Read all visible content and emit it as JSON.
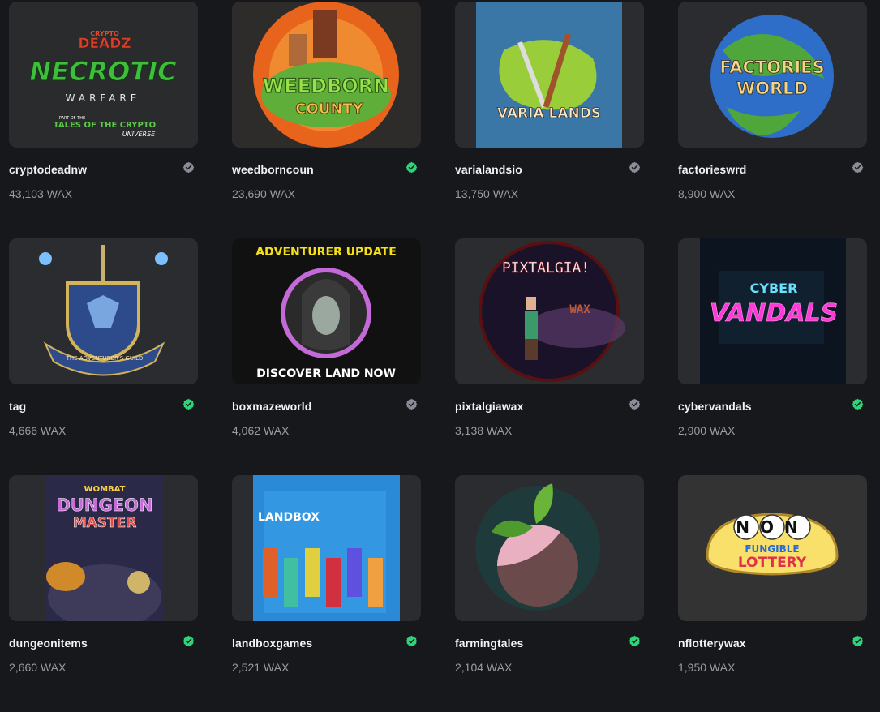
{
  "collections": [
    {
      "name": "cryptodeadnw",
      "volume": "43,103 WAX",
      "verified": false,
      "art": {
        "kind": "crypto",
        "top": "CRYPTO",
        "brand": "DEADZ",
        "title": "NECROTIC",
        "sub": "WARFARE",
        "tag1": "PART OF THE",
        "tag2": "TALES OF THE CRYPTO",
        "tag3": "UNIVERSE"
      }
    },
    {
      "name": "weedborncoun",
      "volume": "23,690 WAX",
      "verified": true,
      "art": {
        "kind": "weed",
        "title": "WEEDBORN",
        "sub": "COUNTY"
      }
    },
    {
      "name": "varialandsio",
      "volume": "13,750 WAX",
      "verified": false,
      "art": {
        "kind": "varia",
        "title": "VARIA LANDS"
      }
    },
    {
      "name": "factorieswrd",
      "volume": "8,900 WAX",
      "verified": false,
      "art": {
        "kind": "factories",
        "title": "FACTORIES",
        "sub": "WORLD"
      }
    },
    {
      "name": "tag",
      "volume": "4,666 WAX",
      "verified": true,
      "art": {
        "kind": "guild",
        "title": "THE ADVENTURER'S GUILD"
      }
    },
    {
      "name": "boxmazeworld",
      "volume": "4,062 WAX",
      "verified": false,
      "art": {
        "kind": "boxmaze",
        "top": "ADVENTURER UPDATE",
        "bottom": "DISCOVER LAND NOW"
      }
    },
    {
      "name": "pixtalgiawax",
      "volume": "3,138 WAX",
      "verified": false,
      "art": {
        "kind": "pixtalgia",
        "title": "PIXTALGIA!",
        "sub": "WAX"
      }
    },
    {
      "name": "cybervandals",
      "volume": "2,900 WAX",
      "verified": true,
      "art": {
        "kind": "cyber",
        "title": "CYBER",
        "sub": "VANDALS"
      }
    },
    {
      "name": "dungeonitems",
      "volume": "2,660 WAX",
      "verified": true,
      "art": {
        "kind": "dungeon",
        "top": "WOMBAT",
        "title": "DUNGEON",
        "sub": "MASTER"
      }
    },
    {
      "name": "landboxgames",
      "volume": "2,521 WAX",
      "verified": true,
      "art": {
        "kind": "landbox",
        "title": "LANDBOX"
      }
    },
    {
      "name": "farmingtales",
      "volume": "2,104 WAX",
      "verified": true,
      "art": {
        "kind": "farming"
      }
    },
    {
      "name": "nflotterywax",
      "volume": "1,950 WAX",
      "verified": true,
      "art": {
        "kind": "lottery",
        "top": "NON",
        "mid": "FUNGIBLE",
        "bottom": "LOTTERY"
      }
    }
  ],
  "colors": {
    "verified": "#2ed47a",
    "unverified": "#8a8d96",
    "card": "#2b2c30",
    "bg": "#16181c"
  }
}
